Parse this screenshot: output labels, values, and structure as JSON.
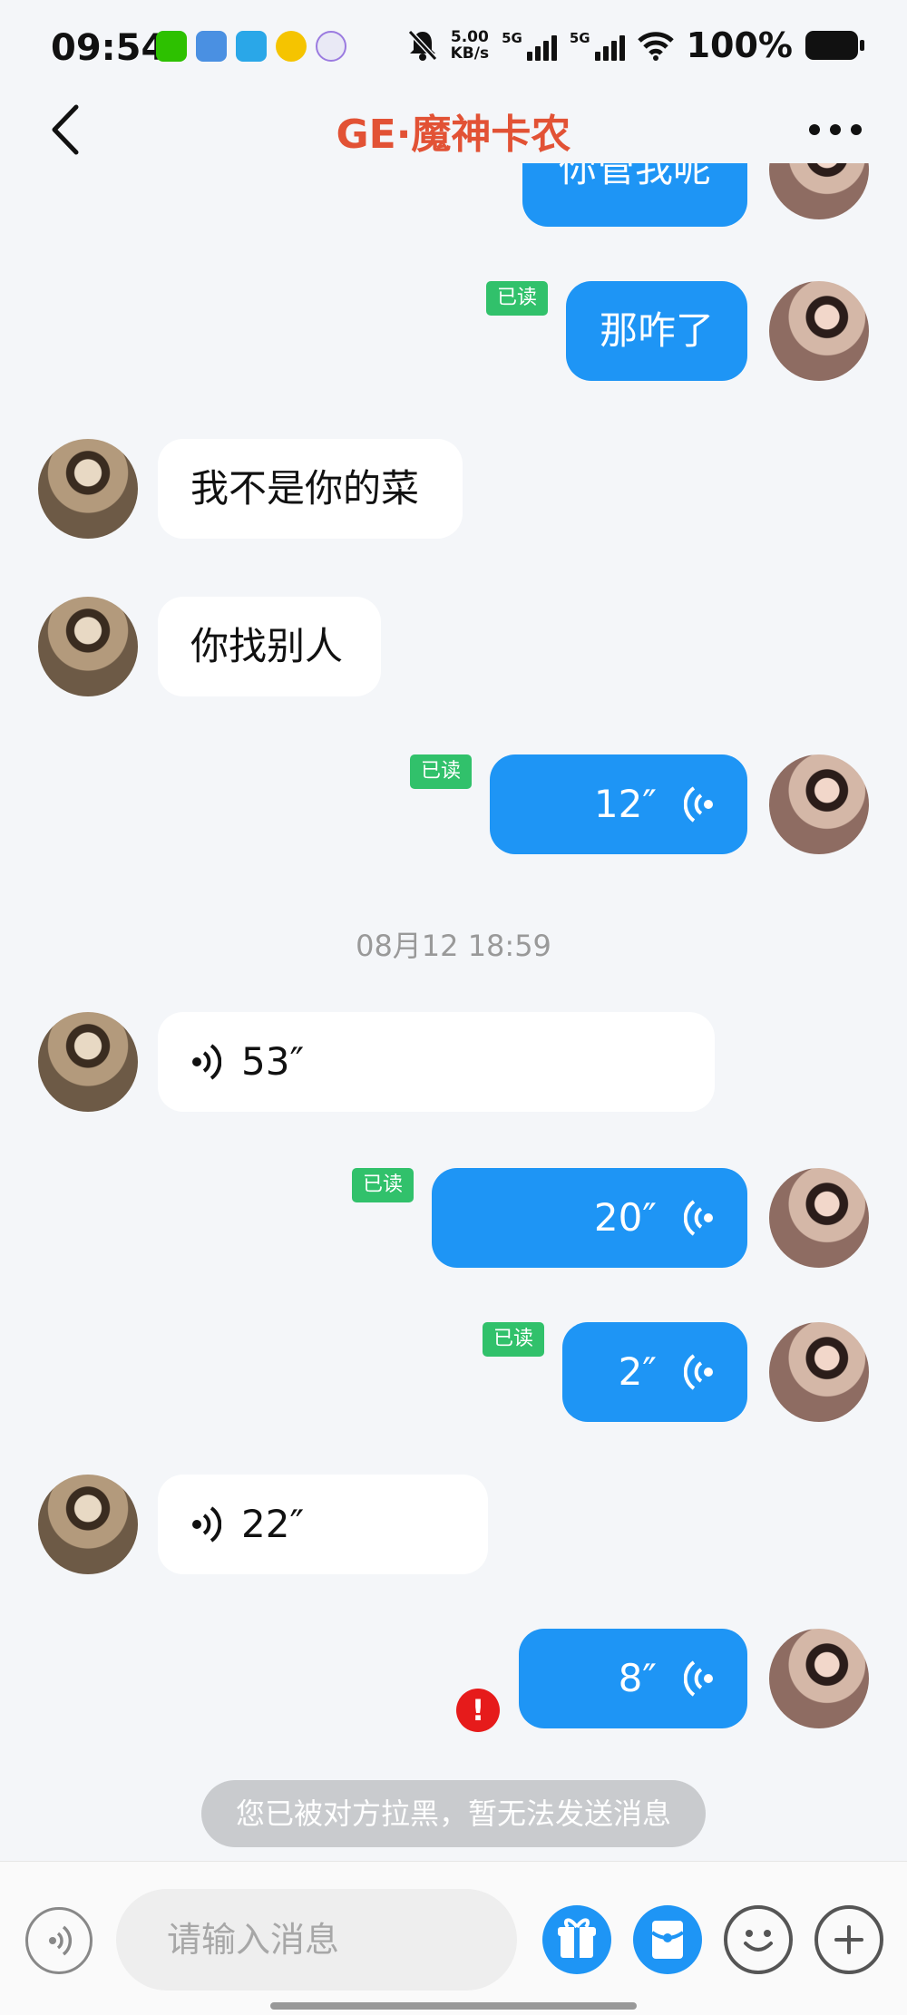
{
  "status_bar": {
    "time": "09:54",
    "net_speed_value": "5.00",
    "net_speed_unit": "KB/s",
    "signal_1_label": "5G",
    "signal_2_label": "5G",
    "battery": "100%",
    "icons": [
      "wechat-icon",
      "files-icon",
      "app-icon",
      "music-icon",
      "camera-app-icon",
      "mute-bell-icon",
      "wifi-icon",
      "battery-icon"
    ]
  },
  "header": {
    "title": "GE·魔神卡农",
    "title_color": "#e25235"
  },
  "messages": {
    "m1_text": "你管我呢",
    "m2_text": "那咋了",
    "m2_read": "已读",
    "m3_text": "我不是你的菜",
    "m4_text": "你找别人",
    "m5_duration": "12″",
    "m5_read": "已读",
    "timestamp": "08月12 18:59",
    "m6_duration": "53″",
    "m7_duration": "20″",
    "m7_read": "已读",
    "m8_duration": "2″",
    "m8_read": "已读",
    "m9_duration": "22″",
    "m10_duration": "8″",
    "m10_failed_mark": "!"
  },
  "notice": {
    "blocked": "您已被对方拉黑，暂无法发送消息"
  },
  "input_bar": {
    "placeholder": "请输入消息"
  },
  "colors": {
    "outgoing_bubble": "#1e95f5",
    "incoming_bubble": "#ffffff",
    "read_badge": "#31c16b",
    "failed_mark": "#e61b1b",
    "background": "#f4f6f9"
  }
}
